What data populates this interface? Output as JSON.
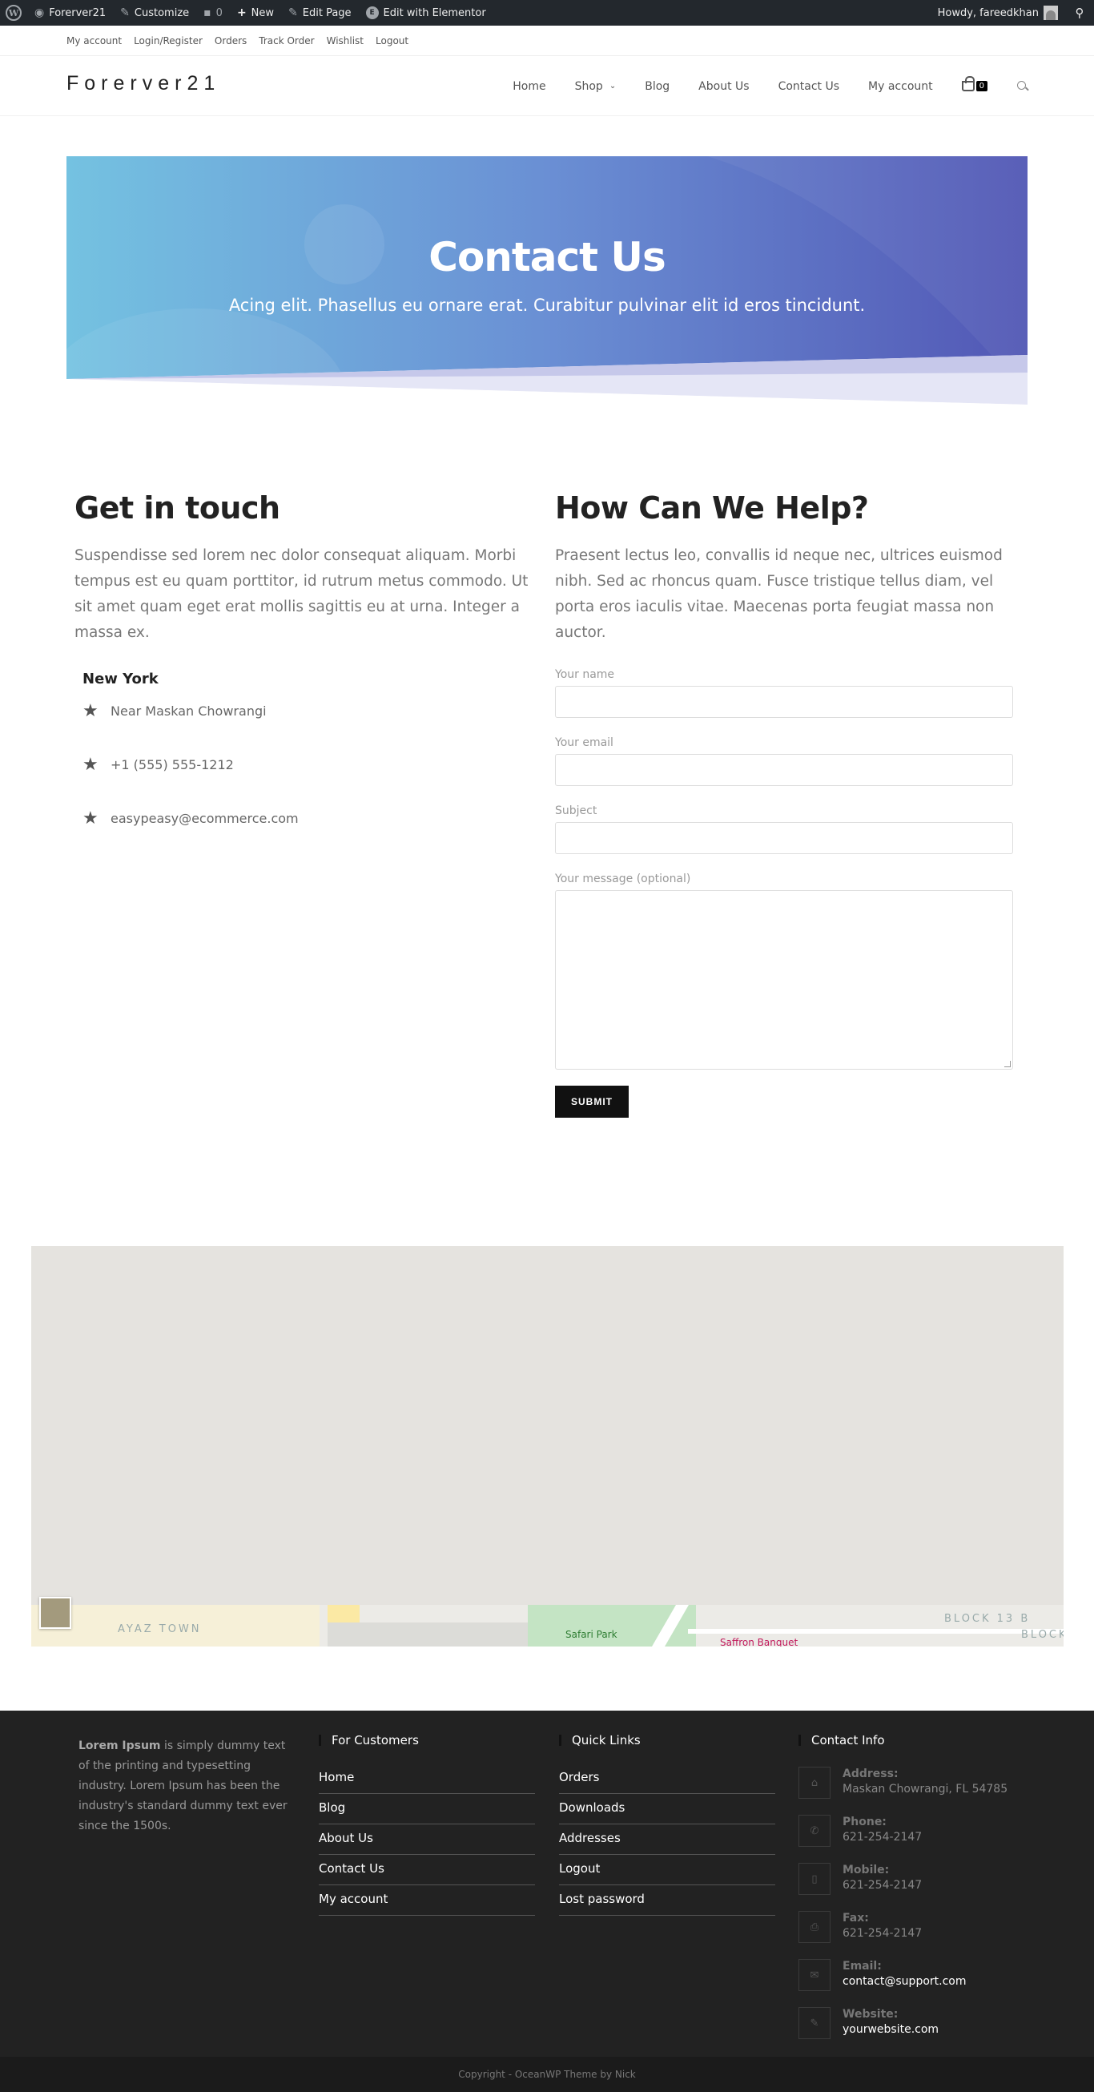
{
  "admin_bar": {
    "site_name": "Forerver21",
    "customize": "Customize",
    "comments": "0",
    "new": "New",
    "edit_page": "Edit Page",
    "edit_elementor": "Edit with Elementor",
    "howdy": "Howdy, fareedkhan"
  },
  "topbar": {
    "links": [
      "My account",
      "Login/Register",
      "Orders",
      "Track Order",
      "Wishlist",
      "Logout"
    ]
  },
  "header": {
    "logo": "Forerver21",
    "nav": [
      "Home",
      "Shop",
      "Blog",
      "About Us",
      "Contact Us",
      "My account"
    ],
    "cart_count": "0"
  },
  "banner": {
    "title": "Contact Us",
    "subtitle": "Acing elit. Phasellus eu ornare erat. Curabitur pulvinar elit id eros tincidunt."
  },
  "get_in_touch": {
    "title": "Get in touch",
    "text": "Suspendisse sed lorem nec dolor consequat aliquam. Morbi tempus est eu quam porttitor, id rutrum metus commodo. Ut sit amet quam eget erat mollis sagittis eu at urna. Integer a massa ex.",
    "city": "New York",
    "address": "Near Maskan Chowrangi",
    "phone": "+1 (555) 555-1212",
    "email": "easypeasy@ecommerce.com"
  },
  "help": {
    "title": "How Can We Help?",
    "text": "Praesent lectus leo, convallis id neque nec, ultrices euismod nibh. Sed ac rhoncus quam. Fusce tristique tellus diam, vel porta eros iaculis vitae. Maecenas porta feugiat massa non auctor.",
    "label_name": "Your name",
    "label_email": "Your email",
    "label_subject": "Subject",
    "label_message": "Your message (optional)",
    "submit": "SUBMIT"
  },
  "map": {
    "labels": [
      "AYAZ TOWN",
      "Safari Park",
      "Saffron Banquet",
      "BLOCK 13 B",
      "BLOCK"
    ]
  },
  "footer": {
    "about_bold": "Lorem Ipsum",
    "about_text": " is simply dummy text of the printing and typesetting industry. Lorem Ipsum has been the industry's standard dummy text ever since the 1500s.",
    "customers_title": "For Customers",
    "customers_links": [
      "Home",
      "Blog",
      "About Us",
      "Contact Us",
      "My account"
    ],
    "quick_title": "Quick Links",
    "quick_links": [
      "Orders",
      "Downloads",
      "Addresses",
      "Logout",
      "Lost password"
    ],
    "contact_title": "Contact Info",
    "contact": [
      {
        "label": "Address:",
        "value": "Maskan Chowrangi, FL 54785",
        "icon": "home-icon"
      },
      {
        "label": "Phone:",
        "value": "621-254-2147",
        "icon": "phone-icon"
      },
      {
        "label": "Mobile:",
        "value": "621-254-2147",
        "icon": "mobile-icon"
      },
      {
        "label": "Fax:",
        "value": "621-254-2147",
        "icon": "fax-icon"
      },
      {
        "label": "Email:",
        "value": "contact@support.com",
        "icon": "envelope-icon"
      },
      {
        "label": "Website:",
        "value": "yourwebsite.com",
        "icon": "pencil-icon"
      }
    ],
    "copyright": "Copyright - OceanWP Theme by Nick"
  }
}
